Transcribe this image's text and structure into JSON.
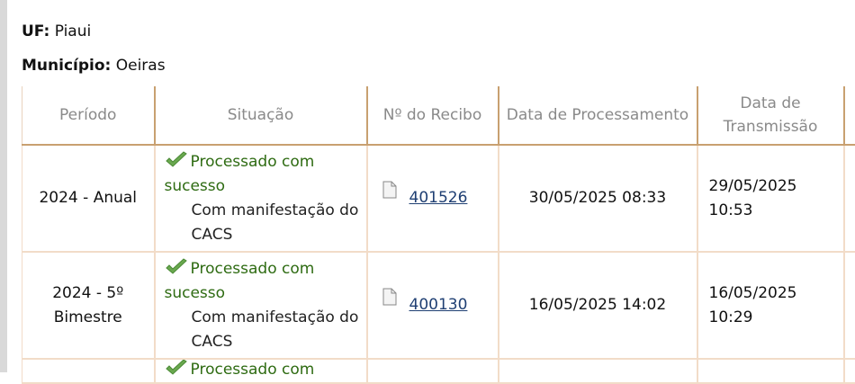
{
  "uf": {
    "label": "UF:",
    "value": "Piaui"
  },
  "municipio": {
    "label": "Município:",
    "value": "Oeiras"
  },
  "table": {
    "headers": [
      "Período",
      "Situação",
      "Nº do Recibo",
      "Data de Processamento",
      "Data de Transmissão"
    ],
    "rows": [
      {
        "periodo": "2024 - Anual",
        "status": "Processado com sucesso",
        "note": "Com manifestação do CACS",
        "recibo": "401526",
        "processamento": "30/05/2025 08:33",
        "transmissao": "29/05/2025 10:53"
      },
      {
        "periodo": "2024 - 5º Bimestre",
        "status": "Processado com sucesso",
        "note": "Com manifestação do CACS",
        "recibo": "400130",
        "processamento": "16/05/2025 14:02",
        "transmissao": "16/05/2025 10:29"
      }
    ],
    "partial_row": {
      "status": "Processado com"
    }
  },
  "colors": {
    "status_ok": "#2e6b12",
    "link": "#1f3f73",
    "header_border": "#c8a070"
  },
  "icons": {
    "status": "check-icon",
    "receipt": "document-icon"
  }
}
